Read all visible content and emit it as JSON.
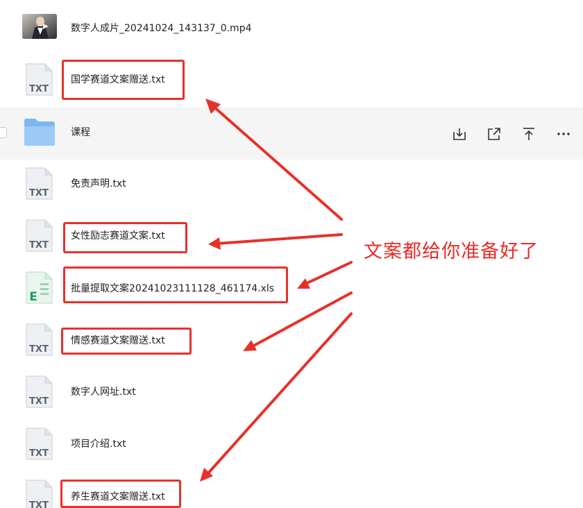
{
  "files": [
    {
      "name": "数字人成片_20241024_143137_0.mp4",
      "type": "video"
    },
    {
      "name": "国学赛道文案赠送.txt",
      "type": "txt"
    },
    {
      "name": "课程",
      "type": "folder"
    },
    {
      "name": "免责声明.txt",
      "type": "txt"
    },
    {
      "name": "女性励志赛道文案.txt",
      "type": "txt"
    },
    {
      "name": "批量提取文案20241023111128_461174.xls",
      "type": "xls"
    },
    {
      "name": "情感赛道文案赠送.txt",
      "type": "txt"
    },
    {
      "name": "数字人网址.txt",
      "type": "txt"
    },
    {
      "name": "项目介绍.txt",
      "type": "txt"
    },
    {
      "name": "养生赛道文案赠送.txt",
      "type": "txt"
    }
  ],
  "icons": {
    "txt_label": "TXT",
    "xls_label": "E"
  },
  "row_actions": [
    "download-icon",
    "share-icon",
    "move-up-icon",
    "more-icon"
  ],
  "annotation": {
    "callout_text": "文案都给你准备好了",
    "color": "#e8302a"
  }
}
